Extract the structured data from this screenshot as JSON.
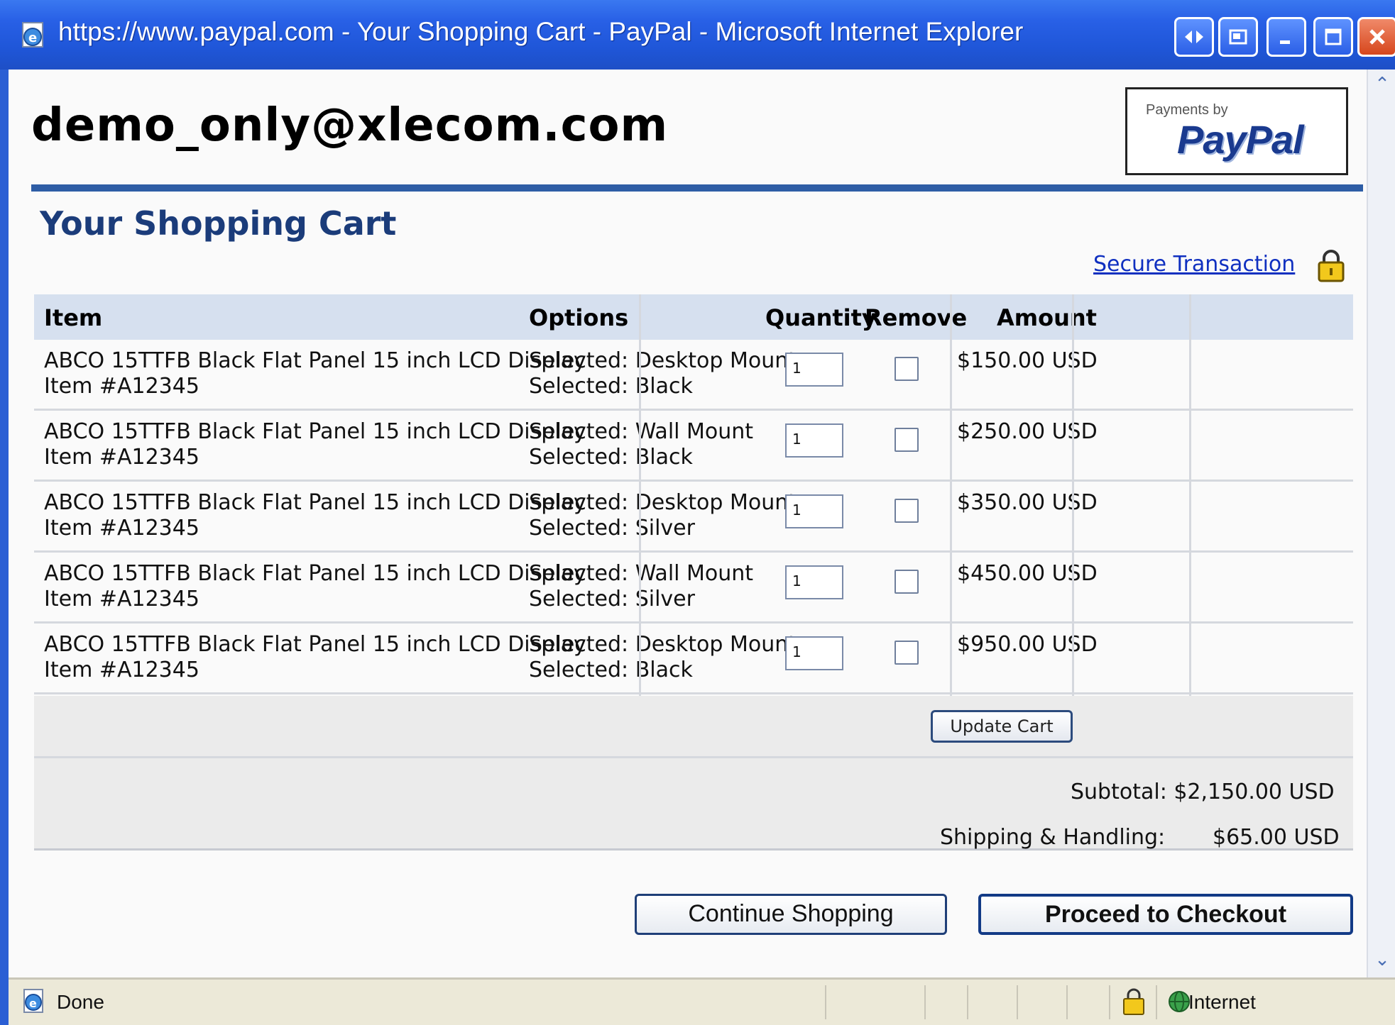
{
  "window": {
    "title": "https://www.paypal.com - Your Shopping Cart - PayPal - Microsoft Internet Explorer",
    "buttons": {
      "minimize": "‒",
      "maximize": "□",
      "close": "✕"
    }
  },
  "header": {
    "email": "demo_only@xlecom.com",
    "logo": {
      "small": "Payments by",
      "brand": "PayPal"
    }
  },
  "cart": {
    "title": "Your Shopping Cart",
    "secure_link": "Secure Transaction",
    "columns": {
      "item": "Item",
      "options": "Options",
      "quantity": "Quantity",
      "remove": "Remove",
      "amount": "Amount"
    },
    "rows": [
      {
        "name": "ABCO 15TTFB Black Flat Panel 15 inch LCD Display",
        "item_no": "Item #A12345",
        "opt1": "Selected: Desktop Mount",
        "opt2": "Selected: Black",
        "qty": "1",
        "amount": "$150.00 USD"
      },
      {
        "name": "ABCO 15TTFB Black Flat Panel 15 inch LCD Display",
        "item_no": "Item #A12345",
        "opt1": "Selected: Wall Mount",
        "opt2": "Selected: Black",
        "qty": "1",
        "amount": "$250.00 USD"
      },
      {
        "name": "ABCO 15TTFB Black Flat Panel 15 inch LCD Display",
        "item_no": "Item #A12345",
        "opt1": "Selected: Desktop Mount",
        "opt2": "Selected: Silver",
        "qty": "1",
        "amount": "$350.00 USD"
      },
      {
        "name": "ABCO 15TTFB Black Flat Panel 15 inch LCD Display",
        "item_no": "Item #A12345",
        "opt1": "Selected: Wall Mount",
        "opt2": "Selected: Silver",
        "qty": "1",
        "amount": "$450.00 USD"
      },
      {
        "name": "ABCO 15TTFB Black Flat Panel 15 inch LCD Display",
        "item_no": "Item #A12345",
        "opt1": "Selected: Desktop Mount",
        "opt2": "Selected: Black",
        "qty": "1",
        "amount": "$950.00 USD"
      }
    ],
    "update_button": "Update Cart",
    "subtotal": "Subtotal: $2,150.00 USD",
    "shipping_label": "Shipping & Handling:",
    "shipping_value": "$65.00 USD"
  },
  "actions": {
    "continue": "Continue Shopping",
    "checkout": "Proceed to Checkout"
  },
  "statusbar": {
    "status": "Done",
    "zone": "Internet"
  },
  "colors": {
    "title_bar": "#2860e6",
    "brand_blue": "#1b3c7a",
    "rule_blue": "#2e5da5",
    "header_row": "#d6e0ef",
    "link": "#1030c0"
  }
}
